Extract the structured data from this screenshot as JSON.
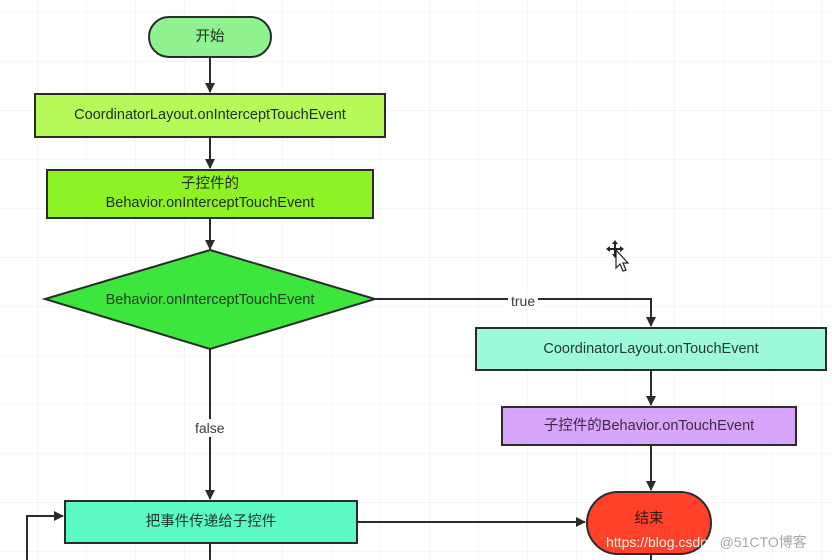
{
  "diagram": {
    "type": "flowchart",
    "nodes": {
      "start": {
        "label": "开始",
        "shape": "terminal",
        "color": "#8ff28f"
      },
      "coordinator_intercept": {
        "label": "CoordinatorLayout.onInterceptTouchEvent",
        "shape": "process",
        "color": "#b5fa59"
      },
      "child_behavior_intercept": {
        "line1": "子控件的",
        "line2": "Behavior.onInterceptTouchEvent",
        "shape": "process",
        "color": "#8ef225"
      },
      "decision": {
        "label": "Behavior.onInterceptTouchEvent",
        "shape": "decision",
        "color": "#3ce63c"
      },
      "coordinator_touch": {
        "label": "CoordinatorLayout.onTouchEvent",
        "shape": "process",
        "color": "#9cfadb"
      },
      "child_behavior_touch": {
        "label": "子控件的Behavior.onTouchEvent",
        "shape": "process",
        "color": "#d7a6fb"
      },
      "dispatch_to_child": {
        "label": "把事件传递给子控件",
        "shape": "process",
        "color": "#5cfbc5"
      },
      "end": {
        "label": "结束",
        "shape": "terminal",
        "color": "#ff4129"
      }
    },
    "edges": [
      {
        "from": "start",
        "to": "coordinator_intercept",
        "label": ""
      },
      {
        "from": "coordinator_intercept",
        "to": "child_behavior_intercept",
        "label": ""
      },
      {
        "from": "child_behavior_intercept",
        "to": "decision",
        "label": ""
      },
      {
        "from": "decision",
        "to": "coordinator_touch",
        "label": "true"
      },
      {
        "from": "decision",
        "to": "dispatch_to_child",
        "label": "false"
      },
      {
        "from": "coordinator_touch",
        "to": "child_behavior_touch",
        "label": ""
      },
      {
        "from": "child_behavior_touch",
        "to": "end",
        "label": ""
      },
      {
        "from": "dispatch_to_child",
        "to": "end",
        "label": ""
      }
    ],
    "edge_labels": {
      "true": "true",
      "false": "false"
    }
  },
  "watermark": {
    "main": "https://blog.csdn.n",
    "tail": "@51CTO博客"
  },
  "cursor": {
    "icon": "move-cursor-icon"
  }
}
